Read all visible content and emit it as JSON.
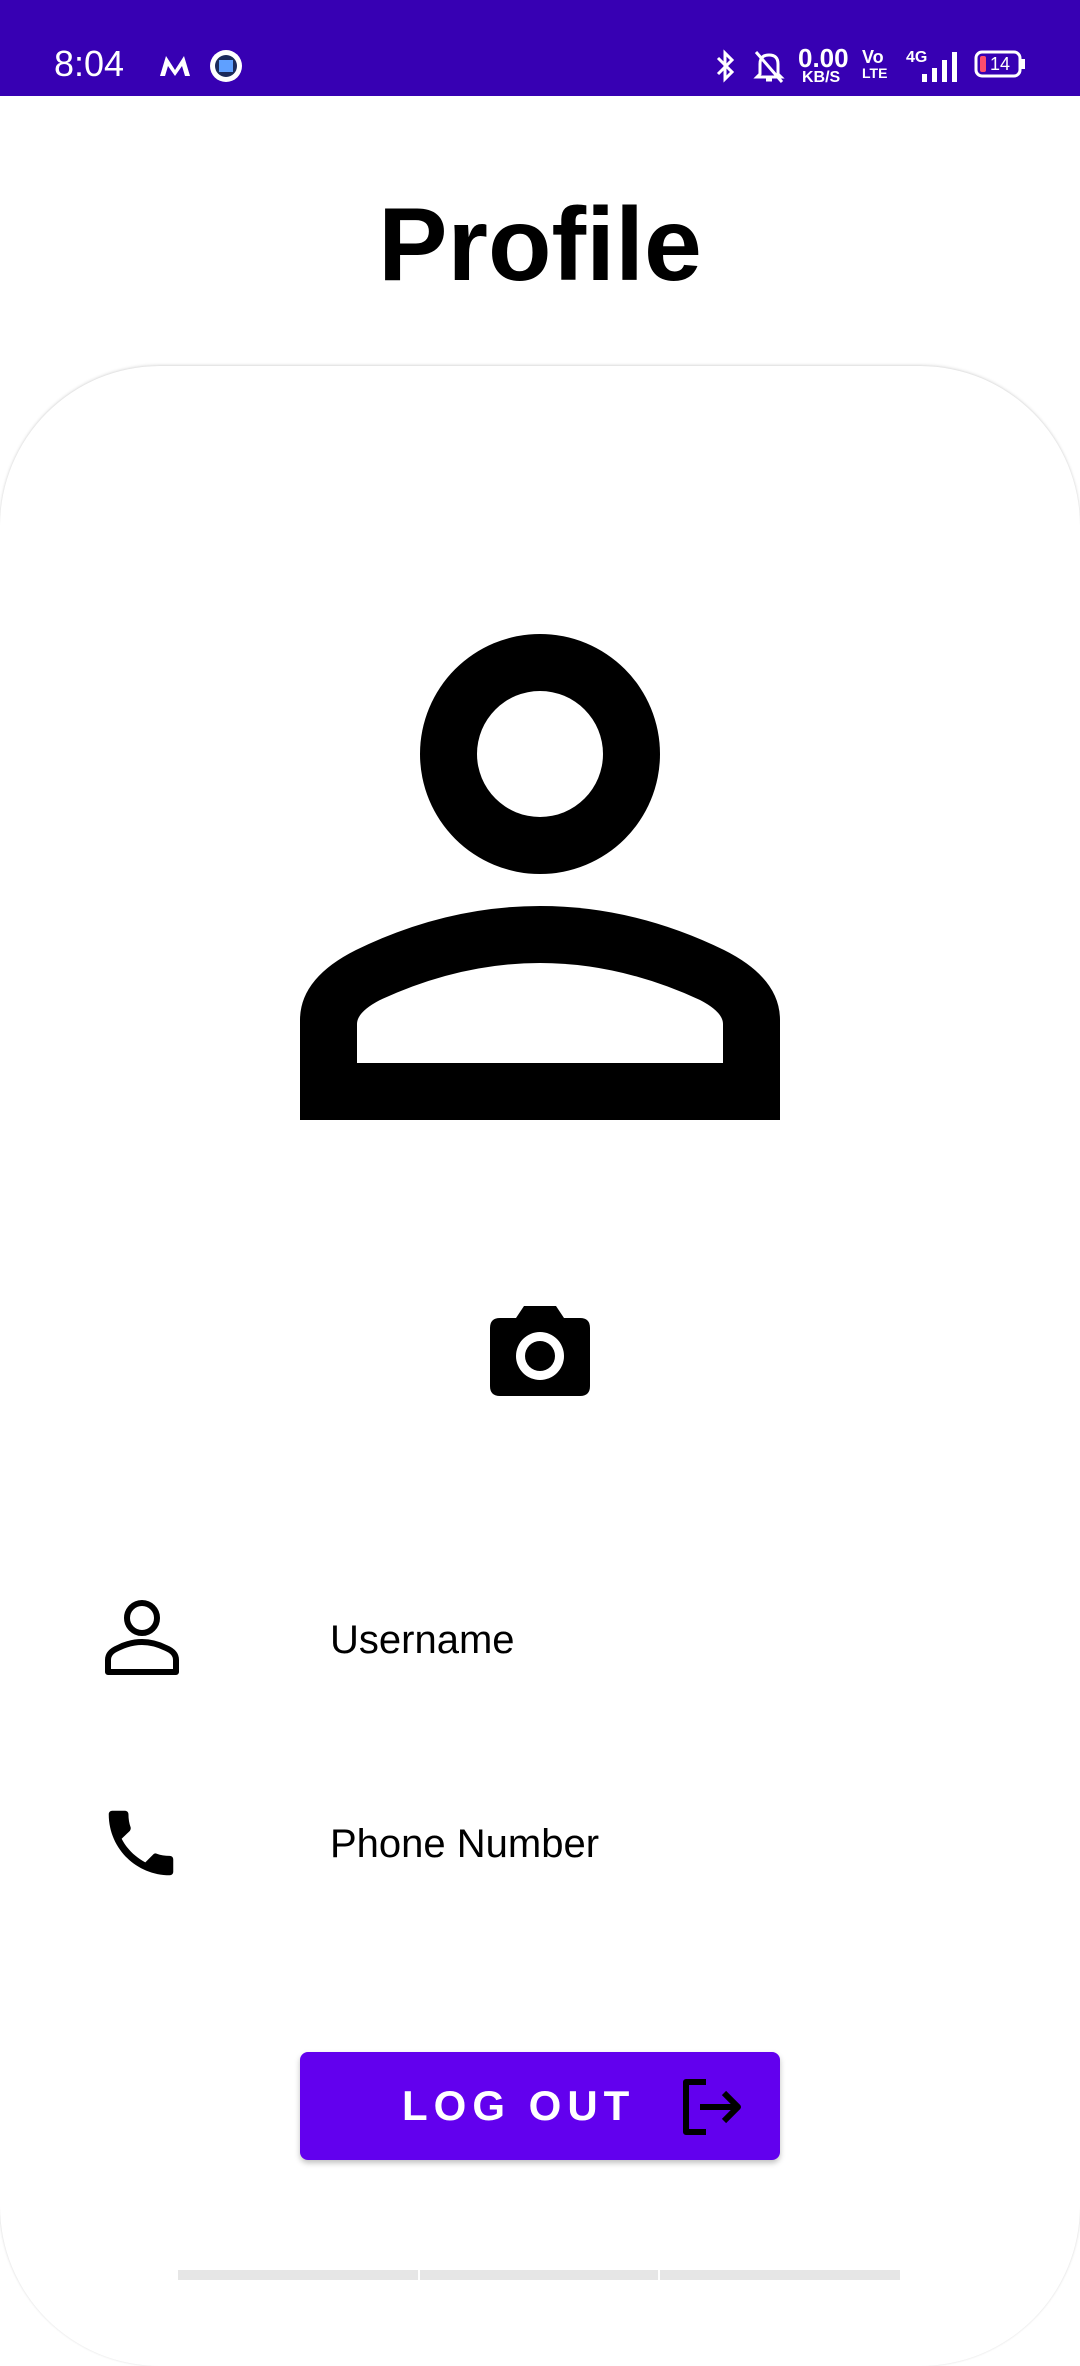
{
  "status_bar": {
    "time": "8:04",
    "carrier_icon": "myntra-logo-icon",
    "app_icon": "app-notification-icon",
    "bluetooth_icon": "bluetooth-icon",
    "mute_icon": "notifications-off-icon",
    "network_speed_value": "0.00",
    "network_speed_unit": "KB/S",
    "volte_line1": "Vo",
    "volte_line2": "LTE",
    "network_type": "4G",
    "signal_icon": "signal-bars-icon",
    "battery_level": "14",
    "background_color": "#3700b3"
  },
  "page": {
    "title": "Profile"
  },
  "profile": {
    "avatar_icon": "person-outline-icon",
    "camera_icon": "camera-icon"
  },
  "fields": {
    "username": {
      "icon": "person-icon",
      "label": "Username"
    },
    "phone": {
      "icon": "phone-icon",
      "label": "Phone Number"
    }
  },
  "actions": {
    "logout_label": "LOG OUT",
    "logout_icon": "logout-icon",
    "accent_color": "#6200ee"
  }
}
